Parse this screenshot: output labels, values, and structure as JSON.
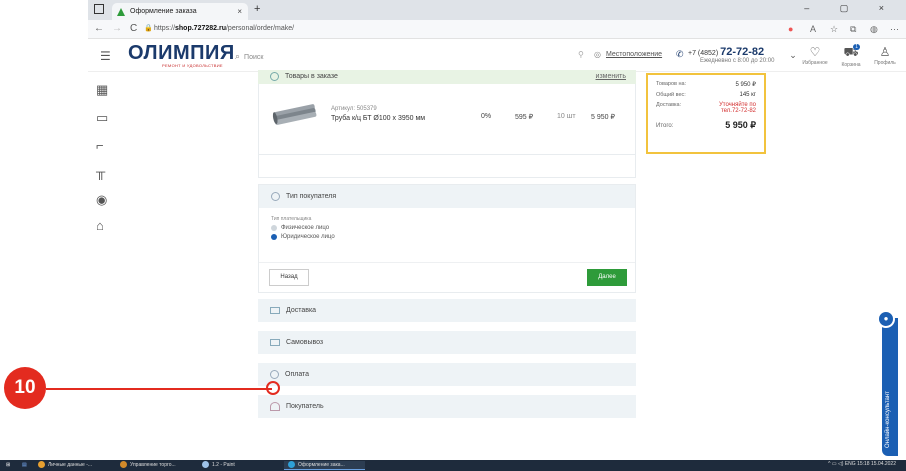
{
  "browser": {
    "tab_title": "Оформление заказа",
    "tab_close": "×",
    "new_tab": "+",
    "url_prefix": "https://",
    "url_host": "shop.727282.ru",
    "url_path": "/personal/order/make/",
    "window_controls": "–  ▢  ×",
    "nav_back": "←",
    "nav_forward": "→",
    "nav_reload": "C",
    "url_lock": "🔒"
  },
  "header": {
    "logo_text": "ОЛИМПИЯ",
    "logo_sub": "РЕМОНТ И УДОВОЛЬСТВИЕ",
    "search_placeholder": "Поиск",
    "location": "Местоположение",
    "phone_prefix": "+7 (4852)",
    "phone_number": "72-72-82",
    "phone_hours": "Ежедневно с 8:00 до 20:00",
    "favorites_label": "Избранное",
    "cart_label": "Корзина",
    "cart_count": "1",
    "profile_label": "Профиль"
  },
  "order": {
    "goods_title": "Товары в заказе",
    "change_label": "изменить",
    "item": {
      "article": "Артикул: 505379",
      "name": "Труба к/ц БТ Ø100 х 3950 мм",
      "discount": "0%",
      "price": "595 ₽",
      "qty": "10 шт",
      "total": "5 950 ₽"
    },
    "buyer_type_title": "Тип покупателя",
    "payer_type_label": "Тип плательщика",
    "payer_options": [
      {
        "label": "Физическое лицо",
        "selected": false
      },
      {
        "label": "Юридическое лицо",
        "selected": true
      }
    ],
    "back_label": "Назад",
    "next_label": "Далее",
    "sections": [
      {
        "label": "Доставка",
        "icon": "truck-icon"
      },
      {
        "label": "Самовывоз",
        "icon": "truck-icon"
      },
      {
        "label": "Оплата",
        "icon": "payment-icon"
      },
      {
        "label": "Покупатель",
        "icon": "person-icon"
      }
    ]
  },
  "summary": {
    "goods_label": "Товаров на:",
    "goods_value": "5 950 ₽",
    "weight_label": "Общий вес:",
    "weight_value": "145 кг",
    "delivery_label": "Доставка:",
    "delivery_value": "Уточняйте по тел.72-72-82",
    "total_label": "Итого:",
    "total_value": "5 950 ₽"
  },
  "consult": {
    "label": "Онлайн-консультант"
  },
  "taskbar": {
    "items": [
      "Личные данные -...",
      "Управление торго...",
      "1.2 - Paint",
      "Оформление зака..."
    ],
    "lang": "ENG",
    "time": "15:18",
    "date": "15.04.2022"
  },
  "annotation": {
    "step": "10"
  },
  "colors": {
    "accent_green": "#2e9b3a",
    "brand_blue": "#1b3a6b",
    "summary_border": "#f2c33d",
    "annotation_red": "#e32b1f"
  }
}
